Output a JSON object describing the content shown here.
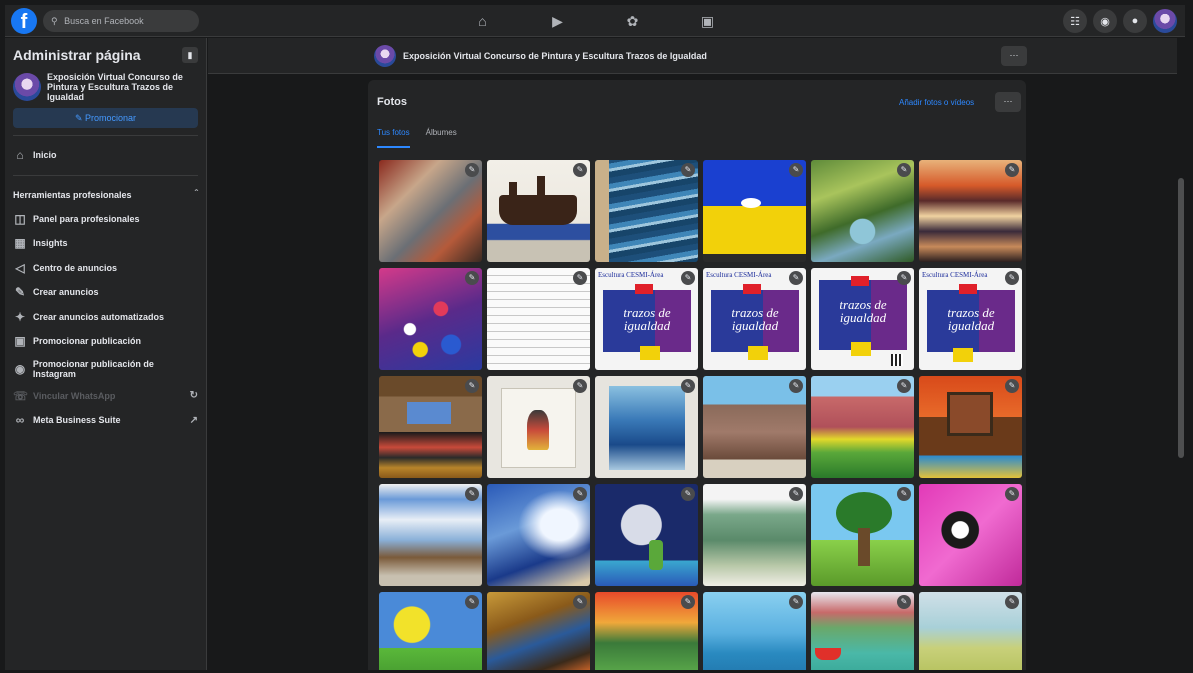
{
  "topbar": {
    "logo": "f",
    "search_placeholder": "Busca en Facebook",
    "nav_icons": [
      "home-icon",
      "watch-icon",
      "groups-icon",
      "gaming-icon"
    ],
    "right_icons": [
      "menu-grid-icon",
      "messenger-icon",
      "bell-icon"
    ]
  },
  "sidebar": {
    "title": "Administrar página",
    "page_name": "Exposición Virtual Concurso de Pintura y Escultura Trazos de Igualdad",
    "promote_label": "Promocionar",
    "inicio": "Inicio",
    "tools_section": "Herramientas profesionales",
    "items": [
      {
        "label": "Panel para profesionales"
      },
      {
        "label": "Insights"
      },
      {
        "label": "Centro de anuncios"
      },
      {
        "label": "Crear anuncios"
      },
      {
        "label": "Crear anuncios automatizados"
      },
      {
        "label": "Promocionar publicación"
      },
      {
        "label": "Promocionar publicación de Instagram"
      },
      {
        "label": "Vincular WhatsApp"
      },
      {
        "label": "Meta Business Suite"
      }
    ]
  },
  "page_header": {
    "title": "Exposición Virtual Concurso de Pintura y Escultura Trazos de Igualdad",
    "more": "···"
  },
  "photos": {
    "title": "Fotos",
    "add_link": "Añadir fotos o vídeos",
    "more": "···",
    "tabs": [
      {
        "label": "Tus fotos",
        "active": true
      },
      {
        "label": "Álbumes",
        "active": false
      }
    ],
    "poster_school": "Escultura CESMI-Área",
    "poster_title": "trazos de igualdad"
  },
  "colors": {
    "background": "#18191a",
    "surface": "#242526",
    "accent": "#2d88ff",
    "brand": "#1877f2"
  }
}
